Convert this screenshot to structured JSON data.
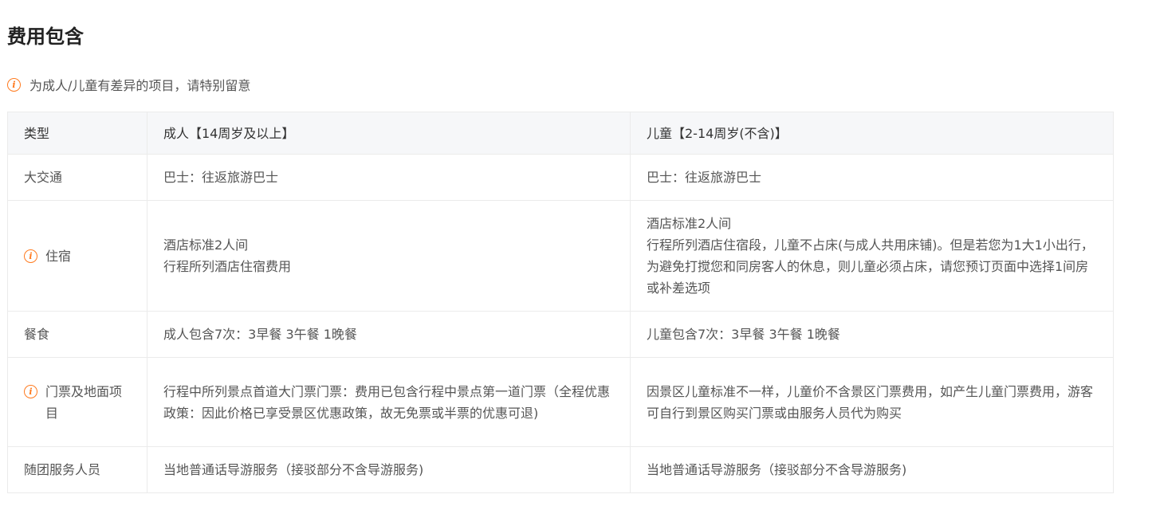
{
  "section": {
    "title": "费用包含",
    "notice": "为成人/儿童有差异的项目，请特别留意"
  },
  "table": {
    "headers": [
      "类型",
      "成人【14周岁及以上】",
      "儿童【2-14周岁(不含)】"
    ],
    "rows": [
      {
        "type": "大交通",
        "marked": false,
        "adult": [
          "巴士：往返旅游巴士"
        ],
        "child": [
          "巴士：往返旅游巴士"
        ]
      },
      {
        "type": "住宿",
        "marked": true,
        "adult": [
          "酒店标准2人间",
          "行程所列酒店住宿费用"
        ],
        "child": [
          "酒店标准2人间",
          "行程所列酒店住宿段，儿童不占床(与成人共用床铺)。但是若您为1大1小出行，为避免打搅您和同房客人的休息，则儿童必须占床，请您预订页面中选择1间房或补差选项"
        ]
      },
      {
        "type": "餐食",
        "marked": false,
        "adult": [
          "成人包含7次：3早餐 3午餐 1晚餐"
        ],
        "child": [
          "儿童包含7次：3早餐 3午餐 1晚餐"
        ]
      },
      {
        "type": "门票及地面项目",
        "marked": true,
        "adult": [
          "行程中所列景点首道大门票门票：费用已包含行程中景点第一道门票（全程优惠政策：因此价格已享受景区优惠政策，故无免票或半票的优惠可退)"
        ],
        "child": [
          "因景区儿童标准不一样，儿童价不含景区门票费用，如产生儿童门票费用，游客可自行到景区购买门票或由服务人员代为购买"
        ]
      },
      {
        "type": "随团服务人员",
        "marked": false,
        "adult": [
          "当地普通话导游服务（接驳部分不含导游服务)"
        ],
        "child": [
          "当地普通话导游服务（接驳部分不含导游服务)"
        ]
      }
    ]
  },
  "icons": {
    "info": "info-circle-icon"
  },
  "colors": {
    "accent": "#ff7a1f",
    "header_bg": "#f6f7f9",
    "border": "#ebebeb"
  }
}
